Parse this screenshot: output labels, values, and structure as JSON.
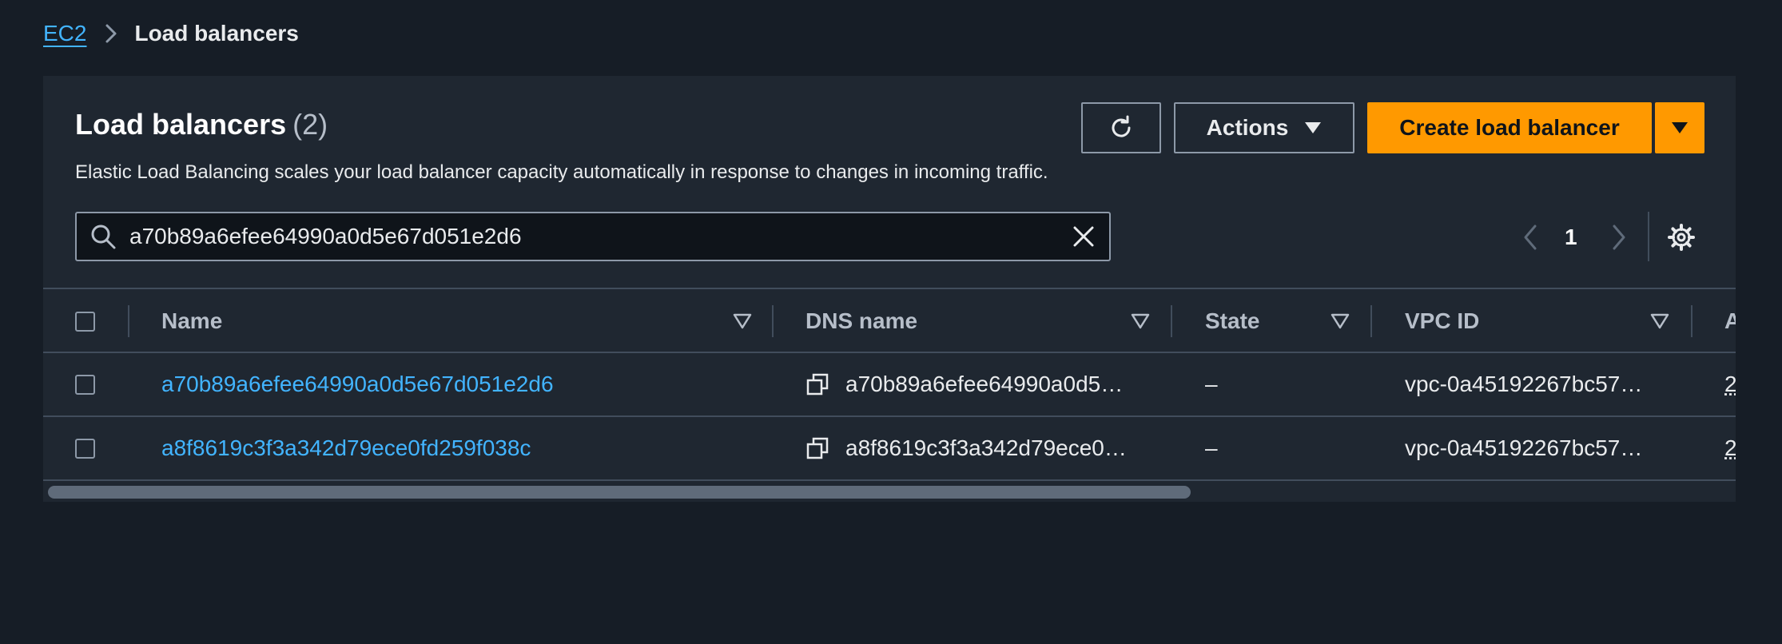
{
  "breadcrumb": {
    "root": "EC2",
    "current": "Load balancers"
  },
  "header": {
    "title": "Load balancers",
    "count": "(2)",
    "description": "Elastic Load Balancing scales your load balancer capacity automatically in response to changes in incoming traffic."
  },
  "toolbar": {
    "actions_label": "Actions",
    "create_label": "Create load balancer"
  },
  "search": {
    "value": "a70b89a6efee64990a0d5e67d051e2d6"
  },
  "pagination": {
    "current_page": "1"
  },
  "table": {
    "columns": [
      "Name",
      "DNS name",
      "State",
      "VPC ID",
      "A"
    ],
    "rows": [
      {
        "name": "a70b89a6efee64990a0d5e67d051e2d6",
        "dns": "a70b89a6efee64990a0d5…",
        "state": "–",
        "vpc": "vpc-0a45192267bc57…",
        "next": "2"
      },
      {
        "name": "a8f8619c3f3a342d79ece0fd259f038c",
        "dns": "a8f8619c3f3a342d79ece0…",
        "state": "–",
        "vpc": "vpc-0a45192267bc57…",
        "next": "2"
      }
    ]
  },
  "colors": {
    "background": "#161d26",
    "panel": "#1f2731",
    "link": "#42b4ff",
    "primary_button": "#ff9900",
    "header_text": "#b6bec9"
  },
  "icons": [
    "chevron-right-icon",
    "refresh-icon",
    "caret-down-icon",
    "search-icon",
    "clear-icon",
    "chevron-left-icon",
    "settings-gear-icon",
    "sort-icon",
    "copy-icon"
  ]
}
